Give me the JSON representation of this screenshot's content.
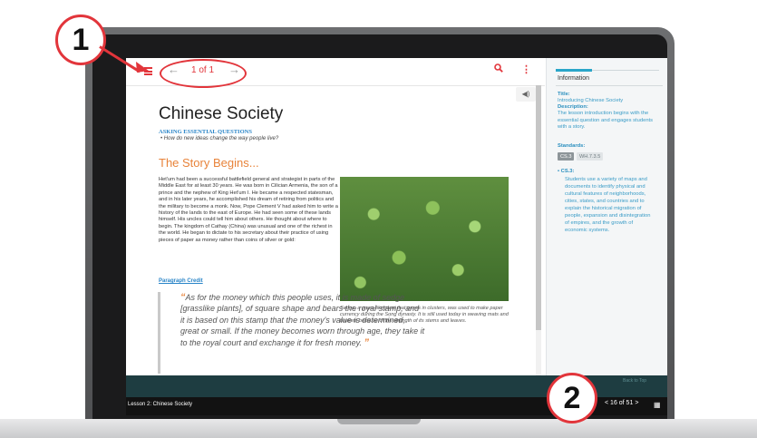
{
  "toolbar": {
    "page_indicator": "1 of 1",
    "prev_arrow": "←",
    "next_arrow": "→",
    "search_icon": "search-icon",
    "more_icon": "more-vertical-icon",
    "menu_icon": "hamburger-menu-icon"
  },
  "lesson": {
    "title": "Chinese Society",
    "essential_label": "ASKING ESSENTIAL QUESTIONS",
    "essential_question": "How do new ideas change the way people live?",
    "section_title": "The Story Begins...",
    "body": "Het'um had been a successful battlefield general and strategist in parts of the Middle East for at least 30 years. He was born in Cilician Armenia, the son of a prince and the nephew of King Het'um I. He became a respected statesman, and in his later years, he accomplished his dream of retiring from politics and the military to become a monk. Now, Pope Clement V had asked him to write a history of the lands to the east of Europe. He had seen some of these lands himself. His uncles could tell him about others. He thought about where to begin. The kingdom of Cathay (China) was unusual and one of the richest in the world. He began to dictate to his secretary about their practice of using pieces of paper as money rather than coins of silver or gold:",
    "credit_link": "Paragraph Credit",
    "quote": "As for the money which this people uses, it is made of sedge [grasslike plants], of square shape and bears the royal stamp, and it is based on this stamp that the money's value is determined, great or small. If the money becomes worn through age, they take it to the royal court and exchange it for fresh money.",
    "open_quote": "“",
    "close_quote": "”",
    "caption": "Sedge, a grass-like plant that grows in clusters, was used to make paper currency during the Song dynasty. It is still used today in weaving mats and baskets because of the strength of its stems and leaves."
  },
  "info_panel": {
    "heading": "Information",
    "title_label": "Title:",
    "title_value": "Introducing Chinese Society",
    "description_label": "Description:",
    "description_value": "The lesson introduction begins with the essential question and engages students with a story.",
    "standards_label": "Standards:",
    "standards": [
      "CS.3",
      "WH.7.3.5"
    ],
    "cs_heading": "CS.3:",
    "cs_text": "Students use a variety of maps and documents to identify physical and cultural features of neighborhoods, cities, states, and countries and to explain the historical migration of people, expansion and disintegration of empires, and the growth of economic systems."
  },
  "bottom_bar": {
    "lesson_name": "Lesson 2: Chinese Society",
    "pager": "16 of 51",
    "back_to_top": "Back to Top"
  },
  "callouts": {
    "one": "1",
    "two": "2"
  },
  "colors": {
    "accent_red": "#e2353b",
    "orange_heading": "#e8833a",
    "link_blue": "#2a85c8",
    "info_teal": "#2aa6c9"
  }
}
